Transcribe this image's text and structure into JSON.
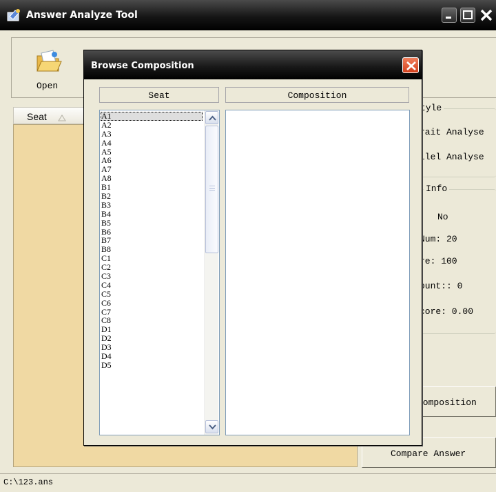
{
  "main_window": {
    "title": "Answer Analyze Tool",
    "icon": "app-icon",
    "controls": [
      "minimize-icon",
      "maximize-icon",
      "close-icon"
    ]
  },
  "toolbar": {
    "open_label": "Open",
    "open_icon": "open-folder-icon"
  },
  "seat_list": {
    "column_header": "Seat",
    "sort_icon": "sort-up-icon",
    "background_color": "#f0d9a3"
  },
  "right_panel": {
    "style_group_title": "tyle",
    "style_options": [
      "rait Analyse",
      "llel Analyse"
    ],
    "info_group_title": "Info",
    "info_lines": [
      "No",
      "Num:  20",
      "re:  100",
      "ount:: 0",
      "core: 0.00"
    ],
    "browse_composition_label": "Composition",
    "compare_answer_label": "Compare Answer"
  },
  "status_bar": {
    "path": "C:\\123.ans"
  },
  "dialog": {
    "title": "Browse Composition",
    "close_icon": "close-icon",
    "close_color": "#e0522c",
    "seat_column": "Seat",
    "composition_column": "Composition",
    "seats": [
      "A1",
      "A2",
      "A3",
      "A4",
      "A5",
      "A6",
      "A7",
      "A8",
      "B1",
      "B2",
      "B3",
      "B4",
      "B5",
      "B6",
      "B7",
      "B8",
      "C1",
      "C2",
      "C3",
      "C4",
      "C5",
      "C6",
      "C7",
      "C8",
      "D1",
      "D2",
      "D3",
      "D4",
      "D5"
    ],
    "selected_seat": "A1",
    "composition_text": ""
  }
}
